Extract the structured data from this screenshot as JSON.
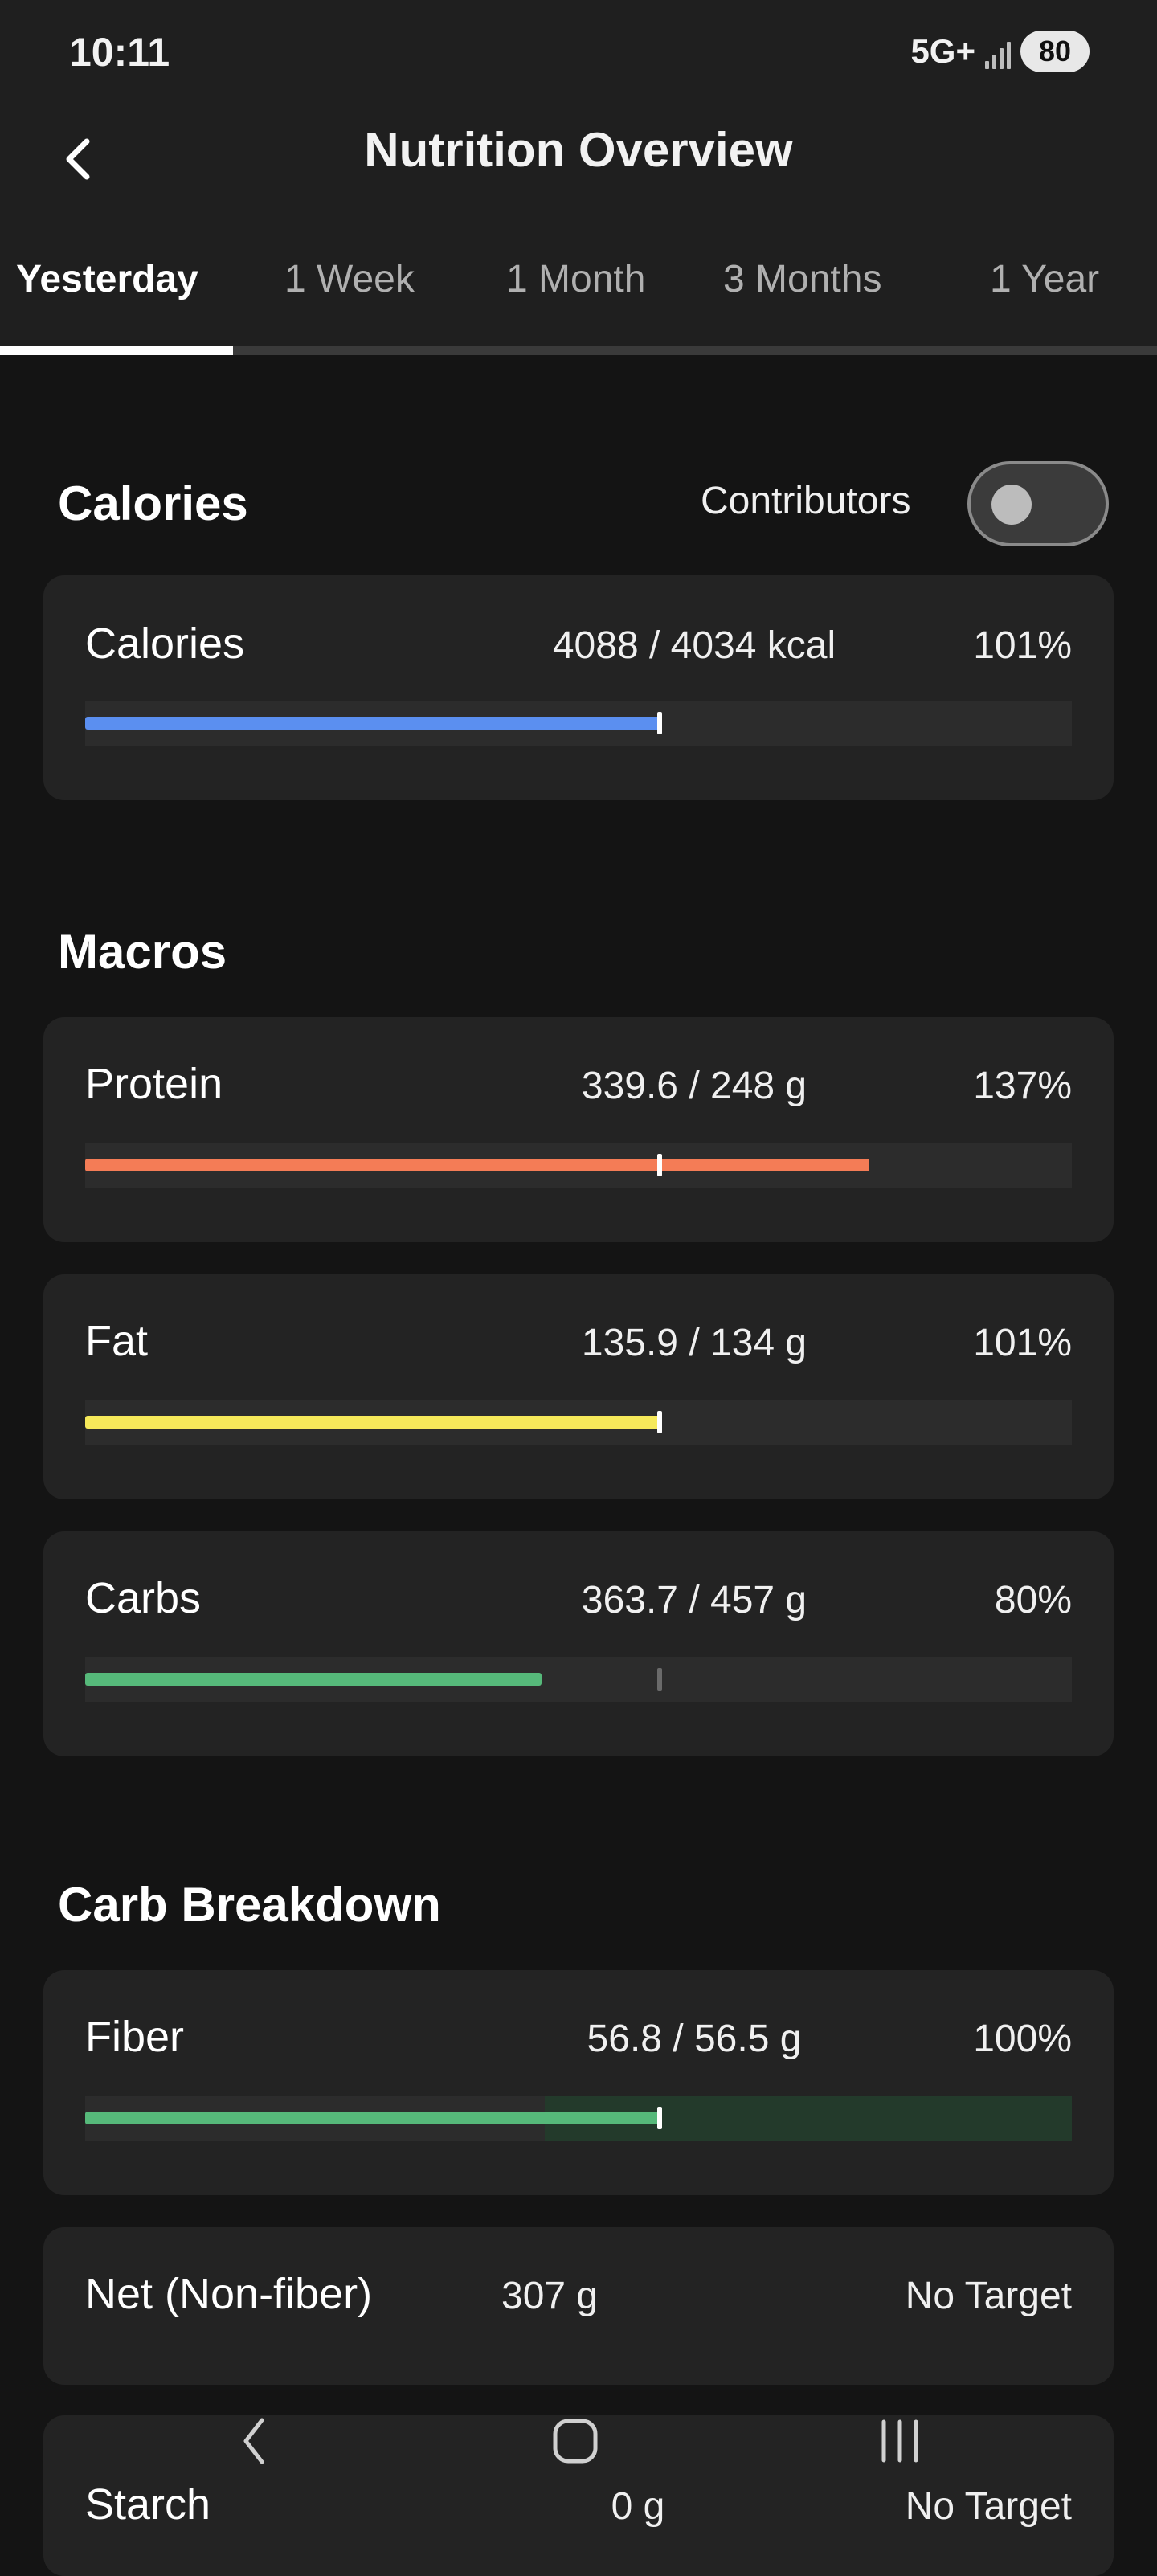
{
  "status": {
    "time": "10:11",
    "network": "5G+",
    "battery": "80"
  },
  "header": {
    "title": "Nutrition Overview",
    "back_icon": "chevron-left-icon"
  },
  "tabs": [
    {
      "label": "Yesterday",
      "active": true
    },
    {
      "label": "1 Week",
      "active": false
    },
    {
      "label": "1 Month",
      "active": false
    },
    {
      "label": "3 Months",
      "active": false
    },
    {
      "label": "1 Year",
      "active": false
    }
  ],
  "calories_section": {
    "title": "Calories",
    "contributors_label": "Contributors",
    "contributors_on": false,
    "item": {
      "label": "Calories",
      "value": "4088 / 4034 kcal",
      "percent": "101%",
      "color": "#5b8ff0",
      "fill": 0.5829
    }
  },
  "macros_section": {
    "title": "Macros",
    "items": [
      {
        "label": "Protein",
        "value": "339.6 / 248 g",
        "percent": "137%",
        "color": "#f47c56",
        "fill": 0.7948
      },
      {
        "label": "Fat",
        "value": "135.9 / 134 g",
        "percent": "101%",
        "color": "#f6e95a",
        "fill": 0.5839
      },
      {
        "label": "Carbs",
        "value": "363.7 / 457 g",
        "percent": "80%",
        "color": "#56b97a",
        "fill": 0.4628
      }
    ]
  },
  "carb_section": {
    "title": "Carb Breakdown",
    "items": [
      {
        "label": "Fiber",
        "value": "56.8 / 56.5 g",
        "percent": "100%",
        "color": "#56b97a",
        "fill": 0.5813
      },
      {
        "label": "Net (Non-fiber)",
        "value": "307 g",
        "percent": "No Target"
      },
      {
        "label": "Starch",
        "value": "0 g",
        "percent": "No Target"
      }
    ]
  },
  "colors": {
    "background": "#141414",
    "card": "#232323",
    "track": "#2c2c2c",
    "fiber_target_zone": "#233a2b"
  },
  "nav": {
    "back_icon": "nav-back-icon",
    "home_icon": "nav-home-icon",
    "recents_icon": "nav-recents-icon"
  }
}
